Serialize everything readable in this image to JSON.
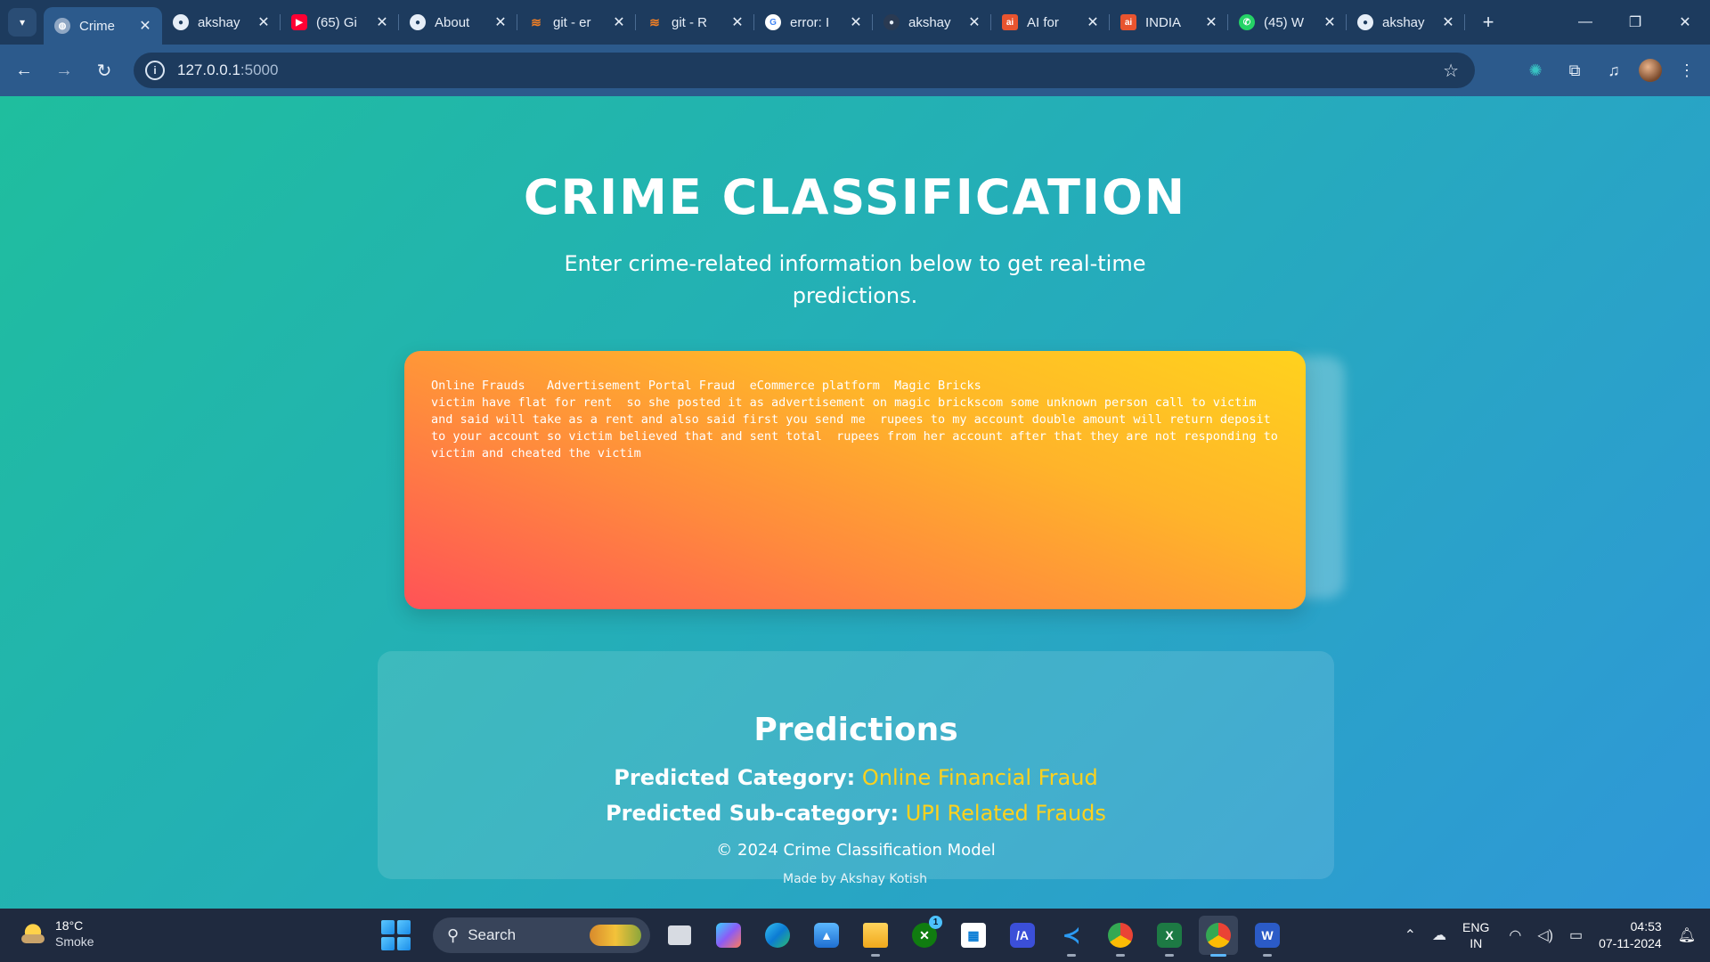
{
  "browser": {
    "tabs": [
      {
        "title": "Crime",
        "favicon": "globe-icon",
        "active": true
      },
      {
        "title": "akshay",
        "favicon": "github-icon"
      },
      {
        "title": "(65) Gi",
        "favicon": "youtube-icon"
      },
      {
        "title": "About",
        "favicon": "github-icon"
      },
      {
        "title": "git - er",
        "favicon": "stackoverflow-icon"
      },
      {
        "title": "git - R",
        "favicon": "stackoverflow-icon"
      },
      {
        "title": "error: I",
        "favicon": "google-icon"
      },
      {
        "title": "akshay",
        "favicon": "github-icon"
      },
      {
        "title": "AI for",
        "favicon": "ai-icon"
      },
      {
        "title": "INDIA",
        "favicon": "ai-icon"
      },
      {
        "title": "(45) W",
        "favicon": "whatsapp-icon"
      },
      {
        "title": "akshay",
        "favicon": "github-icon"
      }
    ],
    "url_host": "127.0.0.1",
    "url_port": ":5000"
  },
  "page": {
    "title": "CRIME CLASSIFICATION",
    "subtitle": "Enter crime-related information below to get real-time predictions.",
    "input_text": "Online Frauds   Advertisement Portal Fraud  eCommerce platform  Magic Bricks\nvictim have flat for rent  so she posted it as advertisement on magic brickscom some unknown person call to victim and said will take as a rent and also said first you send me  rupees to my account double amount will return deposit to your account so victim believed that and sent total  rupees from her account after that they are not responding to victim and cheated the victim",
    "predictions": {
      "heading": "Predictions",
      "category_label": "Predicted Category:",
      "category_value": "Online Financial Fraud",
      "subcategory_label": "Predicted Sub-category:",
      "subcategory_value": "UPI Related Frauds"
    },
    "footer_copy": "© 2024 Crime Classification Model",
    "footer_made": "Made by Akshay Kotish"
  },
  "taskbar": {
    "weather_temp": "18°C",
    "weather_cond": "Smoke",
    "search_label": "Search",
    "store_badge": "1",
    "lang_top": "ENG",
    "lang_bottom": "IN",
    "time": "04:53",
    "date": "07-11-2024"
  },
  "colors": {
    "accent_yellow": "#ffd21d",
    "page_gradient_start": "#1fbe9e",
    "page_gradient_end": "#2f97d8"
  }
}
